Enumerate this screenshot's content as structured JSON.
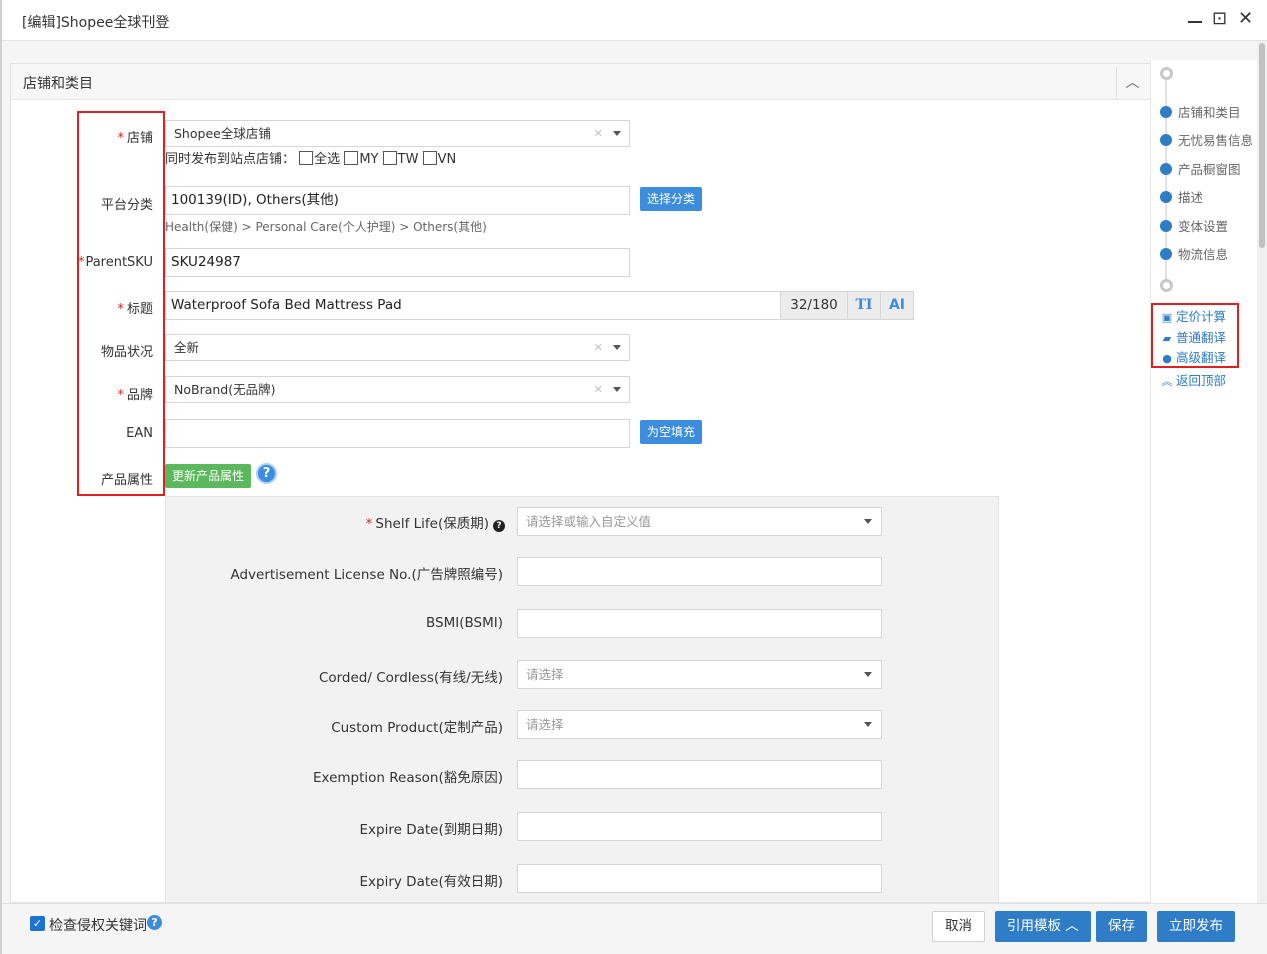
{
  "window": {
    "title": "[编辑]Shopee全球刊登",
    "minimize_icon": "minimize-icon",
    "maximize_glyph": "⊡",
    "close_glyph": "✕"
  },
  "section": {
    "title": "店铺和类目",
    "collapse_glyph": "︿"
  },
  "fields": {
    "store": {
      "label": "店铺",
      "value": "Shopee全球店铺",
      "clear": "✕"
    },
    "sites": {
      "label": "同时发布到站点店铺：",
      "options": [
        "全选",
        "MY",
        "TW",
        "VN"
      ]
    },
    "category": {
      "label": "平台分类",
      "value": "100139(ID), Others(其他)",
      "button": "选择分类",
      "path": "Health(保健) > Personal Care(个人护理) > Others(其他)"
    },
    "parent_sku": {
      "label": "ParentSKU",
      "value": "SKU24987"
    },
    "title": {
      "label": "标题",
      "value": "Waterproof Sofa Bed Mattress Pad",
      "counter": "32/180",
      "tool_text": "TI",
      "tool_ai": "AI"
    },
    "condition": {
      "label": "物品状况",
      "value": "全新",
      "clear": "✕"
    },
    "brand": {
      "label": "品牌",
      "value": "NoBrand(无品牌)",
      "clear": "✕"
    },
    "ean": {
      "label": "EAN",
      "value": "",
      "button": "为空填充"
    },
    "attributes": {
      "label": "产品属性",
      "button": "更新产品属性",
      "help": "?"
    }
  },
  "attribute_panel": {
    "rows": [
      {
        "label": "Shelf Life(保质期)",
        "required": "*",
        "placeholder": "请选择或输入自定义值",
        "type": "select"
      },
      {
        "label": "Advertisement License No.(广告牌照编号)",
        "placeholder": "",
        "type": "input"
      },
      {
        "label": "BSMI(BSMI)",
        "placeholder": "",
        "type": "input"
      },
      {
        "label": "Corded/ Cordless(有线/无线)",
        "placeholder": "请选择",
        "type": "select"
      },
      {
        "label": "Custom Product(定制产品)",
        "placeholder": "请选择",
        "type": "select"
      },
      {
        "label": "Exemption Reason(豁免原因)",
        "placeholder": "",
        "type": "input"
      },
      {
        "label": "Expire Date(到期日期)",
        "placeholder": "",
        "type": "input"
      },
      {
        "label": "Expiry Date(有效日期)",
        "placeholder": "",
        "type": "input"
      }
    ]
  },
  "right_nav": {
    "steps": [
      "店铺和类目",
      "无忧易售信息",
      "产品橱窗图",
      "描述",
      "变体设置",
      "物流信息"
    ],
    "tools": [
      {
        "label": "定价计算",
        "icon": "calculator-icon",
        "glyph": "▣"
      },
      {
        "label": "普通翻译",
        "icon": "book-icon",
        "glyph": "▰"
      },
      {
        "label": "高级翻译",
        "icon": "chat-icon",
        "glyph": "●"
      }
    ],
    "back_to_top": {
      "label": "返回顶部",
      "glyph": "︽"
    }
  },
  "footer": {
    "check_label": "检查侵权关键词",
    "check_glyph": "✓",
    "help": "?",
    "buttons": {
      "cancel": "取消",
      "template": "引用模板 ︿",
      "save": "保存",
      "publish": "立即发布"
    }
  },
  "colors": {
    "accent": "#2f7cc7",
    "button_blue": "#3c8dde",
    "button_green": "#5cb85c",
    "required": "#e02020",
    "highlight_box": "#e02020"
  }
}
